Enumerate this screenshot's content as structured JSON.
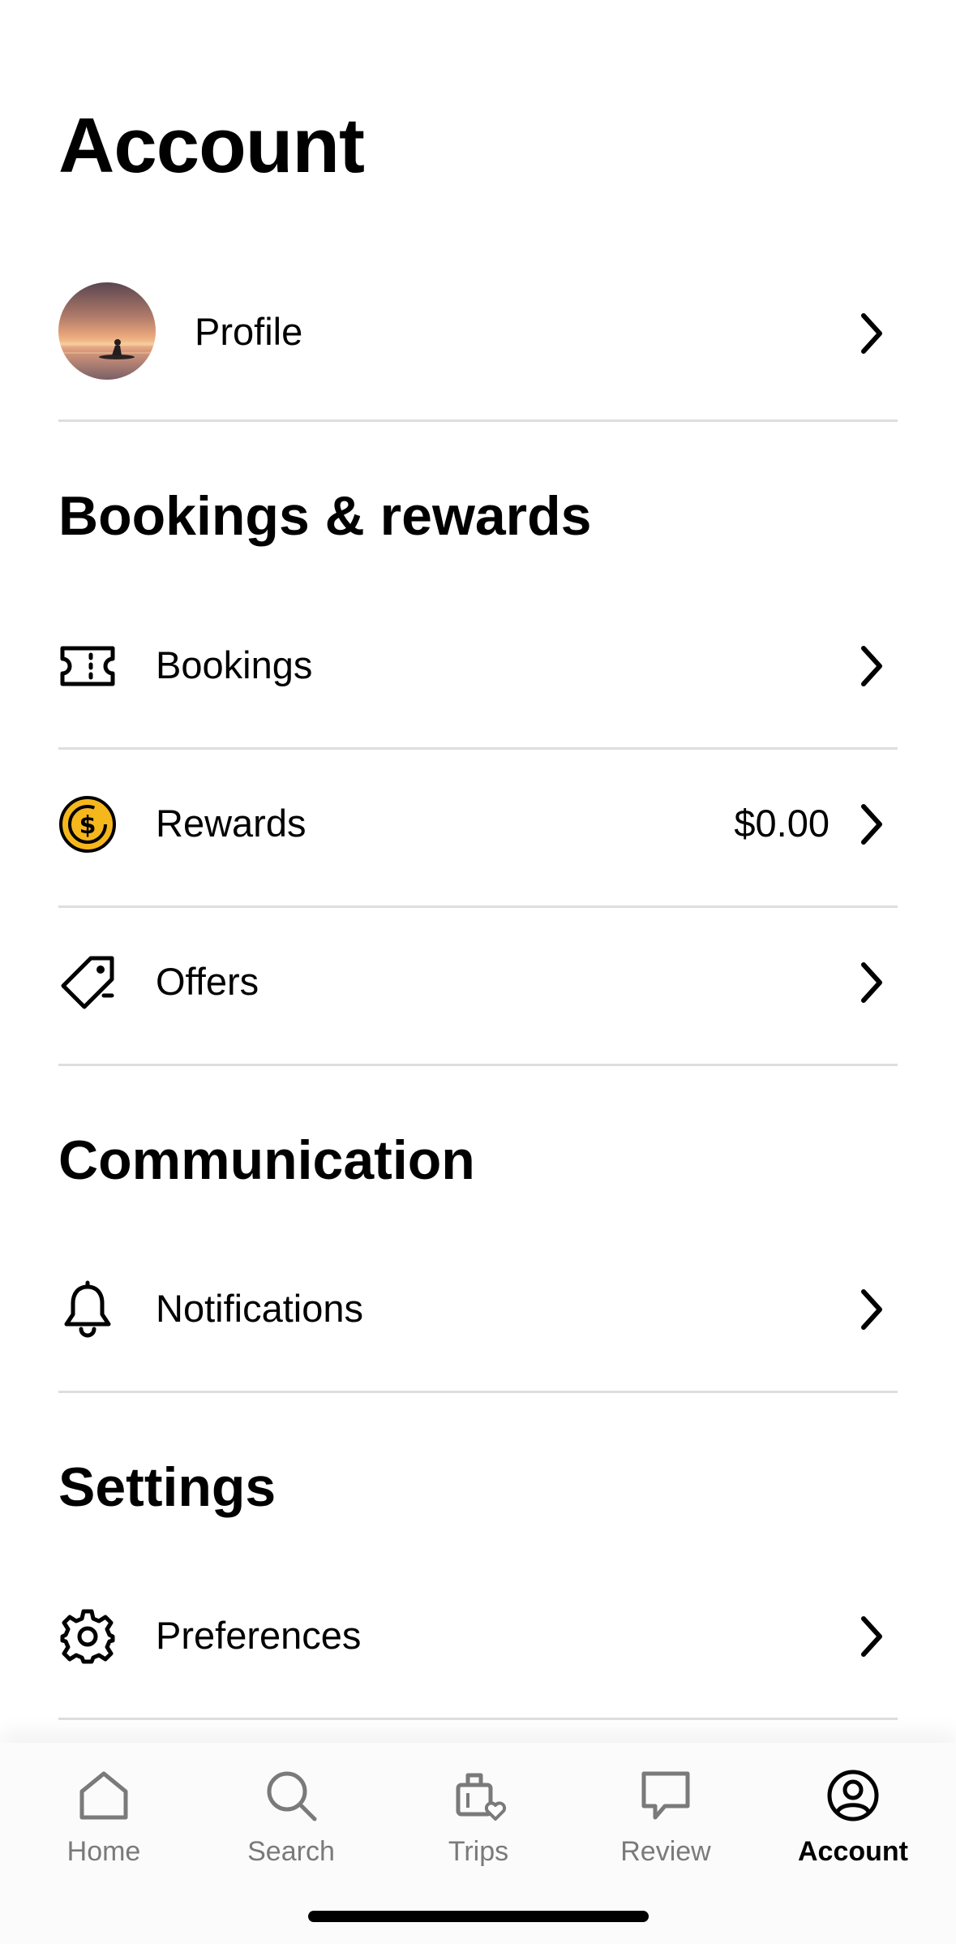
{
  "page": {
    "title": "Account"
  },
  "profile": {
    "label": "Profile",
    "avatar_icon": "sunset-kayak-photo"
  },
  "sections": [
    {
      "heading": "Bookings & rewards",
      "items": [
        {
          "label": "Bookings",
          "icon": "ticket-icon",
          "value": ""
        },
        {
          "label": "Rewards",
          "icon": "dollar-coin-icon",
          "value": "$0.00",
          "icon_color": "#F5B71C"
        },
        {
          "label": "Offers",
          "icon": "tag-icon",
          "value": ""
        }
      ]
    },
    {
      "heading": "Communication",
      "items": [
        {
          "label": "Notifications",
          "icon": "bell-icon",
          "value": ""
        }
      ]
    },
    {
      "heading": "Settings",
      "items": [
        {
          "label": "Preferences",
          "icon": "gear-icon",
          "value": ""
        }
      ]
    }
  ],
  "tabbar": {
    "tabs": [
      {
        "label": "Home",
        "icon": "home-icon",
        "active": false
      },
      {
        "label": "Search",
        "icon": "search-icon",
        "active": false
      },
      {
        "label": "Trips",
        "icon": "suitcase-heart-icon",
        "active": false
      },
      {
        "label": "Review",
        "icon": "speech-bubble-icon",
        "active": false
      },
      {
        "label": "Account",
        "icon": "user-circle-icon",
        "active": true
      }
    ]
  },
  "colors": {
    "text": "#000000",
    "divider": "#DEDEDE",
    "inactive_tab": "#7A7A7A",
    "rewards_coin": "#F5B71C"
  }
}
